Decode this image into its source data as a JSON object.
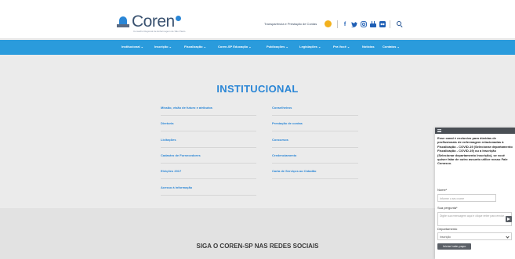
{
  "header": {
    "logo_text": "Coren",
    "logo_subtitle": "Conselho Regional de Enfermagem de São Paulo",
    "transparency_label": "Transparência e Prestação de Contas",
    "social_icons": [
      "facebook-icon",
      "twitter-icon",
      "instagram-icon",
      "youtube-icon",
      "flickr-icon"
    ]
  },
  "nav": {
    "items": [
      "Institucional ⌄",
      "Inscrição ⌄",
      "Fiscalização ⌄",
      "Coren-SP Educação ⌄",
      "Publicações ⌄",
      "Legislações ⌄",
      "Pra Você ⌄",
      "Notícias",
      "Contatos ⌄"
    ]
  },
  "main": {
    "title": "INSTITUCIONAL",
    "left_links": [
      "Missão, visão de futuro e atributos",
      "Diretoria",
      "Licitações",
      "Cadastro de Fornecedores",
      "Eleições 2017",
      "Acesso à informação"
    ],
    "right_links": [
      "Conselheiros",
      "Prestação de contas",
      "Concursos",
      "Credenciamento",
      "Carta de Serviços ao Cidadão"
    ]
  },
  "footer": {
    "follow_title": "SIGA O COREN-SP NAS REDES SOCIAIS"
  },
  "chat": {
    "message": "Esse canal é exclusivo para dúvidas de profissionais de enfermagem relacionadas à Fiscalização - COVID-19 (Selecionar departamento Fiscalização - COVID-19) ou à Inscrição (Selecionar departamento Inscrição), se você quiser falar de outro assunto utilize nosso Fale Conosco.",
    "name_label": "Nome*",
    "name_placeholder": "Informe o seu nome",
    "question_label": "Sua pergunta*",
    "question_placeholder": "Digite sua mensagem aqui e clique enter para enviar...",
    "department_label": "Departamento",
    "department_value": "Inscrição",
    "start_button": "Iniciar bate-papo"
  }
}
